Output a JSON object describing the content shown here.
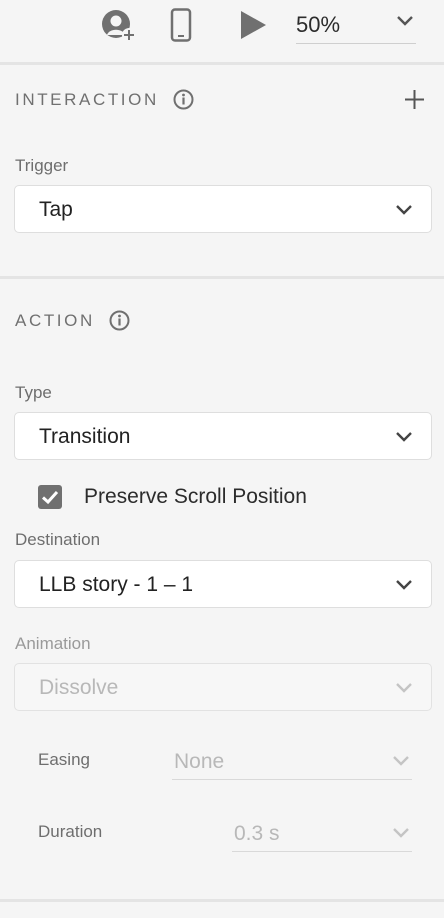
{
  "toolbar": {
    "icons": [
      "user-add-icon",
      "mobile-device-icon",
      "play-icon",
      "chevron-down-icon"
    ],
    "zoom": "50%"
  },
  "interaction": {
    "title": "INTERACTION",
    "trigger_label": "Trigger",
    "trigger_value": "Tap"
  },
  "action": {
    "title": "ACTION",
    "type_label": "Type",
    "type_value": "Transition",
    "preserve_scroll_label": "Preserve Scroll Position",
    "preserve_scroll_checked": true,
    "destination_label": "Destination",
    "destination_value": "LLB story - 1 – 1",
    "animation_label": "Animation",
    "animation_value": "Dissolve",
    "easing_label": "Easing",
    "easing_value": "None",
    "duration_label": "Duration",
    "duration_value": "0.3 s"
  },
  "colors": {
    "background": "#f5f5f5",
    "icon": "#707070",
    "disabled_text": "#b8b8b8"
  }
}
